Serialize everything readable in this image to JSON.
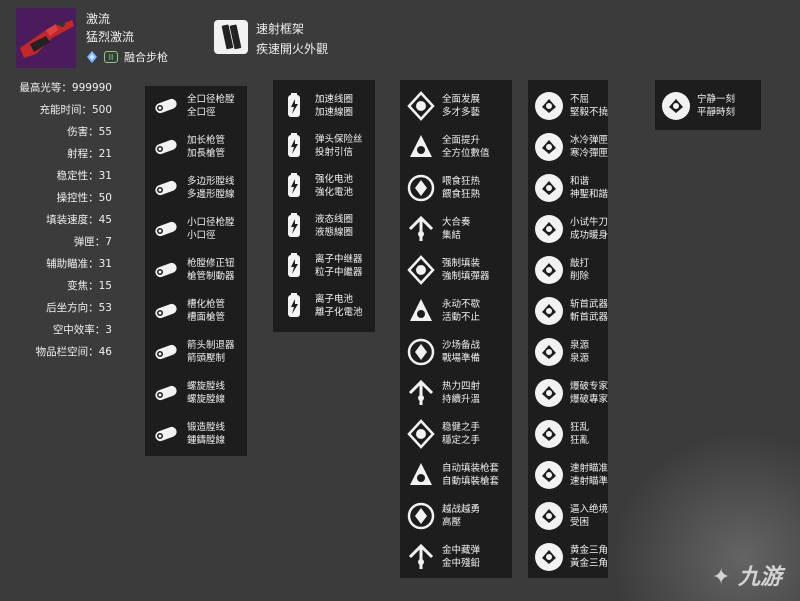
{
  "weapon": {
    "name": "激流",
    "subtitle": "猛烈激流",
    "type": "融合步枪",
    "element_icon": "arc-diamond-icon",
    "ammo_icon": "special-ammo-icon",
    "ammo_label": "II"
  },
  "frame": {
    "name": "速射框架",
    "desc": "疾速開火外觀",
    "icon": "frame-icon"
  },
  "stats": [
    "最高光等：999990",
    "充能时间：500",
    "伤害：55",
    "射程：21",
    "稳定性：31",
    "操控性：50",
    "填装速度：45",
    "弹匣：7",
    "辅助瞄准：31",
    "变焦：15",
    "后坐方向：53",
    "空中效率：3",
    "物品栏空间：46"
  ],
  "barrels": [
    {
      "cn": "全口径枪膛",
      "tw": "全口徑"
    },
    {
      "cn": "加长枪管",
      "tw": "加長槍管"
    },
    {
      "cn": "多边形膛线",
      "tw": "多邊形膛線"
    },
    {
      "cn": "小口径枪膛",
      "tw": "小口徑"
    },
    {
      "cn": "枪膛修正钮",
      "tw": "槍管制動器"
    },
    {
      "cn": "槽化枪管",
      "tw": "槽面槍管"
    },
    {
      "cn": "箭头制退器",
      "tw": "箭頭壓制"
    },
    {
      "cn": "螺旋膛线",
      "tw": "螺旋膛線"
    },
    {
      "cn": "锻造膛线",
      "tw": "鍾鑄膛線"
    }
  ],
  "batteries": [
    {
      "cn": "加速线圈",
      "tw": "加速線圈"
    },
    {
      "cn": "弹头保险丝",
      "tw": "投射引信"
    },
    {
      "cn": "强化电池",
      "tw": "強化電池"
    },
    {
      "cn": "液态线圈",
      "tw": "液態線圈"
    },
    {
      "cn": "离子中继器",
      "tw": "粒子中繼器"
    },
    {
      "cn": "离子电池",
      "tw": "離子化電池"
    }
  ],
  "perks1": [
    {
      "cn": "全面发展",
      "tw": "多才多藝"
    },
    {
      "cn": "全面提升",
      "tw": "全方位數值"
    },
    {
      "cn": "喂食狂热",
      "tw": "餵食狂熱"
    },
    {
      "cn": "大合奏",
      "tw": "集結"
    },
    {
      "cn": "强制填装",
      "tw": "強制填彈器"
    },
    {
      "cn": "永动不歇",
      "tw": "活動不止"
    },
    {
      "cn": "沙场备战",
      "tw": "戰場準備"
    },
    {
      "cn": "热力四射",
      "tw": "持續升溫"
    },
    {
      "cn": "稳健之手",
      "tw": "穩定之手"
    },
    {
      "cn": "自动填装枪套",
      "tw": "自動填裝槍套"
    },
    {
      "cn": "越战越勇",
      "tw": "高壓"
    },
    {
      "cn": "金中藏弹",
      "tw": "金中殘鉛"
    }
  ],
  "perks2": [
    {
      "cn": "不屈",
      "tw": "堅毅不撓"
    },
    {
      "cn": "冰冷弹匣",
      "tw": "寒冷彈匣"
    },
    {
      "cn": "和谐",
      "tw": "神聖和諧"
    },
    {
      "cn": "小试牛刀",
      "tw": "成功暖身"
    },
    {
      "cn": "敲打",
      "tw": "削除"
    },
    {
      "cn": "斩首武器",
      "tw": "斬首武器"
    },
    {
      "cn": "泉源",
      "tw": "泉源"
    },
    {
      "cn": "爆破专家",
      "tw": "爆破專家"
    },
    {
      "cn": "狂乱",
      "tw": "狂亂"
    },
    {
      "cn": "速射瞄准",
      "tw": "速射瞄準"
    },
    {
      "cn": "逼入绝境",
      "tw": "受困"
    },
    {
      "cn": "黄金三角",
      "tw": "黃金三角"
    }
  ],
  "origin": [
    {
      "cn": "宁静一刻",
      "tw": "平靜時刻"
    }
  ],
  "watermark": "九游"
}
